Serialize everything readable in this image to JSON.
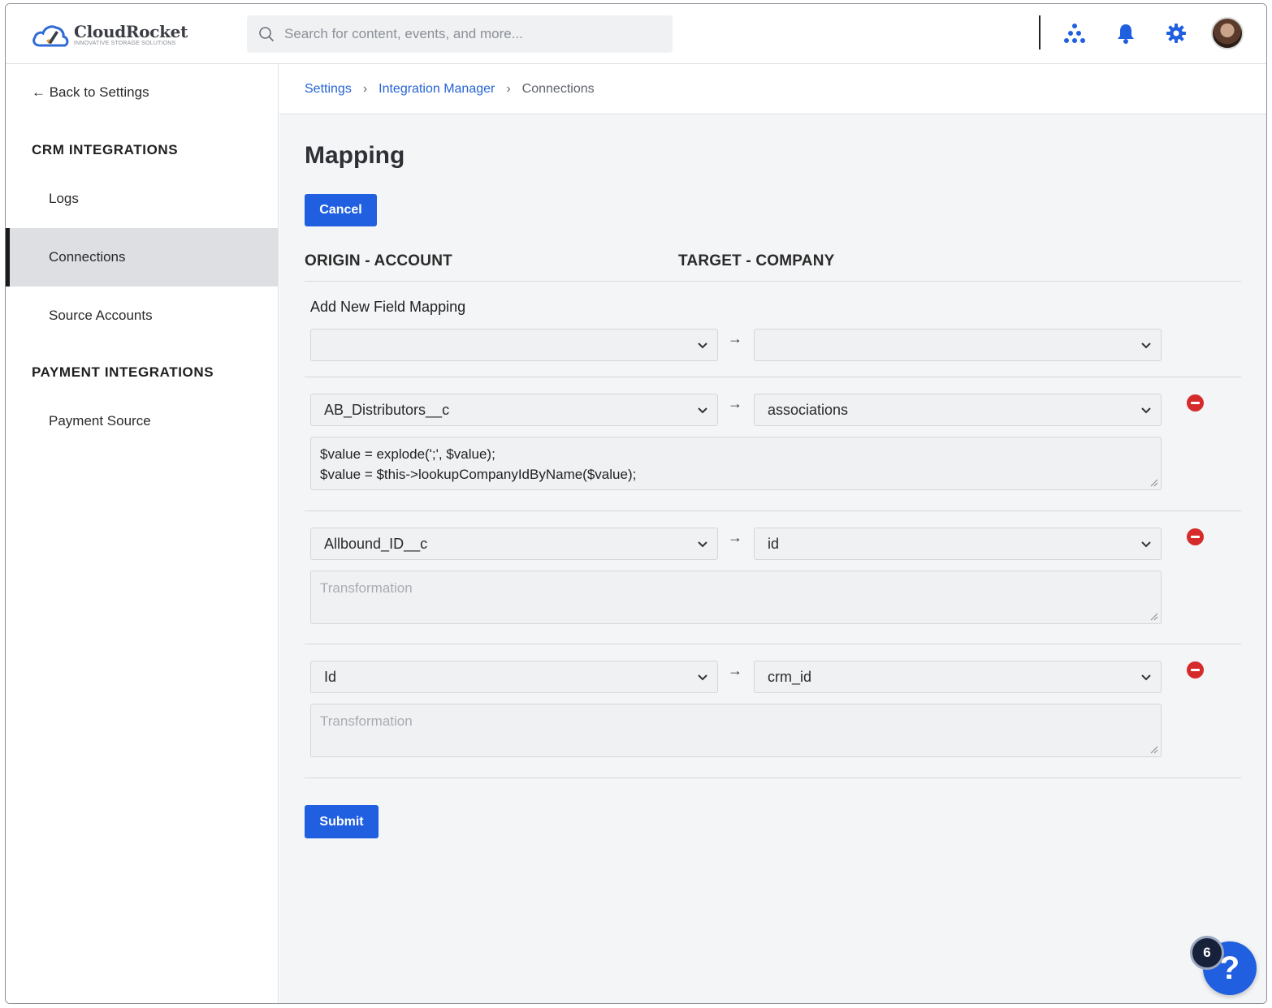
{
  "brand": {
    "name": "CloudRocket",
    "tagline": "INNOVATIVE STORAGE SOLUTIONS"
  },
  "search": {
    "placeholder": "Search for content, events, and more..."
  },
  "header_icons": [
    "org-chart-icon",
    "bell-icon",
    "gear-icon",
    "user-avatar"
  ],
  "sidebar": {
    "back_label": "← Back to Settings",
    "sections": [
      {
        "heading": "CRM INTEGRATIONS",
        "items": [
          {
            "label": "Logs",
            "active": false
          },
          {
            "label": "Connections",
            "active": true
          },
          {
            "label": "Source Accounts",
            "active": false
          }
        ]
      },
      {
        "heading": "PAYMENT INTEGRATIONS",
        "items": [
          {
            "label": "Payment Source",
            "active": false
          }
        ]
      }
    ]
  },
  "breadcrumb": {
    "items": [
      "Settings",
      "Integration Manager",
      "Connections"
    ]
  },
  "page": {
    "title": "Mapping",
    "cancel_label": "Cancel",
    "submit_label": "Submit",
    "origin_heading": "ORIGIN - ACCOUNT",
    "target_heading": "TARGET - COMPANY",
    "add_label": "Add New Field Mapping",
    "arrow": "→",
    "new_mapping": {
      "origin": "",
      "target": ""
    },
    "transformation_placeholder": "Transformation",
    "mappings": [
      {
        "origin": "AB_Distributors__c",
        "target": "associations",
        "transformation_lines": [
          "$value = explode(';', $value);",
          "$value = $this->lookupCompanyIdByName($value);"
        ]
      },
      {
        "origin": "Allbound_ID__c",
        "target": "id",
        "transformation_lines": []
      },
      {
        "origin": "Id",
        "target": "crm_id",
        "transformation_lines": []
      }
    ]
  },
  "help": {
    "label": "?",
    "badge_count": "6"
  },
  "colors": {
    "primary": "#1f5fe0",
    "link": "#2563d4",
    "danger": "#d52b2b",
    "active_nav_bg": "#dddfe3"
  }
}
